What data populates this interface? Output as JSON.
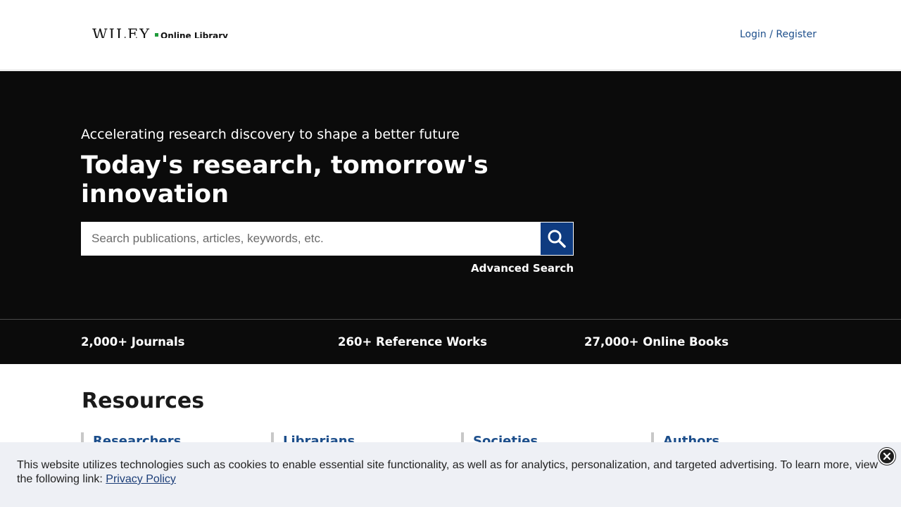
{
  "header": {
    "logo_brand": "WILEY",
    "logo_product": "Online Library",
    "login_label": "Login / Register"
  },
  "hero": {
    "tagline": "Accelerating research discovery to shape a better future",
    "headline": "Today's research, tomorrow's innovation",
    "search": {
      "placeholder": "Search publications, articles, keywords, etc.",
      "value": "",
      "button_icon": "search-icon"
    },
    "advanced_search_label": "Advanced Search"
  },
  "stats": [
    {
      "label": "2,000+ Journals"
    },
    {
      "label": "260+ Reference Works"
    },
    {
      "label": "27,000+ Online Books"
    }
  ],
  "resources": {
    "title": "Resources",
    "items": [
      {
        "label": "Researchers"
      },
      {
        "label": "Librarians"
      },
      {
        "label": "Societies"
      },
      {
        "label": "Authors"
      }
    ]
  },
  "cookie_banner": {
    "text": "This website utilizes technologies such as cookies to enable essential site functionality, as well as for analytics, personalization, and targeted advertising. To learn more, view the following link: ",
    "link_label": "Privacy Policy",
    "close_icon": "close-icon"
  },
  "colors": {
    "hero_bg": "#0b0b0b",
    "link_blue": "#1c4e8b",
    "search_button": "#0e3b80",
    "cookie_bg": "#eef0f5",
    "logo_green": "#1f9b3a"
  }
}
